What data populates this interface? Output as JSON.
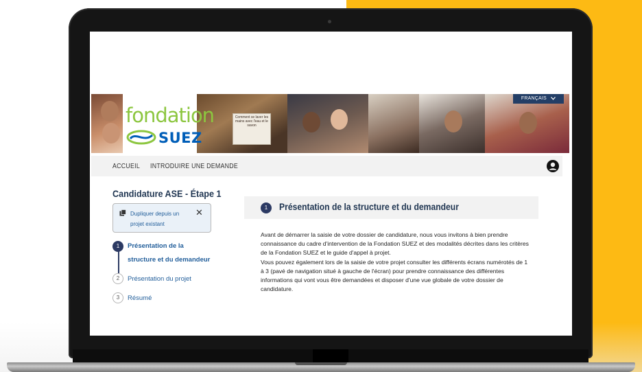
{
  "header": {
    "language_label": "FRANÇAIS",
    "logo_word": "fondation",
    "logo_brand": "SUEZ",
    "poster_text": "Comment se laver les mains avec l'eau et le savon"
  },
  "nav": {
    "home": "ACCUEIL",
    "introduce": "INTRODUIRE UNE DEMANDE"
  },
  "sidebar": {
    "title": "Candidature ASE - Étape 1",
    "duplicate_label": "Dupliquer depuis un projet existant",
    "close_symbol": "✕",
    "steps": [
      {
        "number": "1",
        "label_line1": "Présentation de la",
        "label_line2": "structure et du demandeur",
        "active": true
      },
      {
        "number": "2",
        "label": "Présentation du projet",
        "active": false
      },
      {
        "number": "3",
        "label": "Résumé",
        "active": false
      }
    ]
  },
  "main": {
    "section_number": "1",
    "section_title": "Présentation de la structure et du demandeur",
    "paragraph1": "Avant de démarrer la saisie de votre dossier de candidature, nous vous invitons à bien prendre connaissance du cadre d'intervention de la Fondation SUEZ et des modalités décrites dans les critères de la Fondation SUEZ et le guide d'appel à projet.",
    "paragraph2": "Vous pouvez également lors de la saisie de votre projet consulter les différents écrans numérotés de 1 à 3 (pavé de navigation situé à gauche de l'écran) pour prendre connaissance des différentes informations qui vont vous être demandées et disposer d'une vue globale de votre dossier de candidature."
  },
  "colors": {
    "accent_yellow": "#fdba14",
    "navy": "#2c3a63",
    "link_blue": "#1f5c99",
    "logo_green": "#8cc63f",
    "logo_blue": "#005eb8"
  },
  "icons": [
    "user-account-icon",
    "copy-icon",
    "close-icon",
    "chevron-down-icon"
  ]
}
